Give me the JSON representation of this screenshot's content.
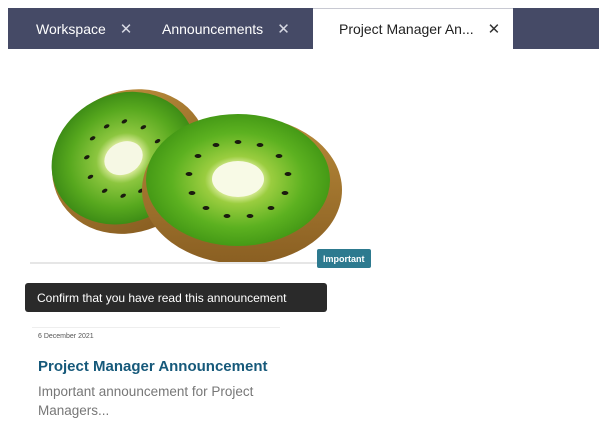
{
  "tabs": [
    {
      "label": "Workspace",
      "active": false
    },
    {
      "label": "Announcements",
      "active": false
    },
    {
      "label": "Project Manager An...",
      "active": true
    }
  ],
  "tab_close_glyph": "✕",
  "card": {
    "image_icon": "kiwi-image",
    "badge": "Important",
    "tooltip": "Confirm that you have read this announcement",
    "date": "6 December 2021",
    "title": "Project Manager Announcement",
    "description": "Important announcement for Project Managers..."
  },
  "colors": {
    "tabbar": "#454a66",
    "badge": "#2d7a8f",
    "title": "#16597a",
    "tooltip": "#2a2a2a"
  }
}
